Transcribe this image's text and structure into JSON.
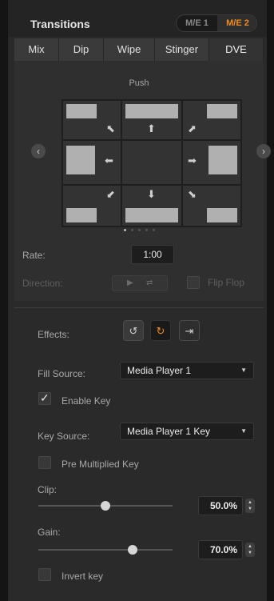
{
  "panel": {
    "title": "Transitions",
    "me_left": "M/E 1",
    "me_right": "M/E 2"
  },
  "tabs": [
    {
      "label": "Mix"
    },
    {
      "label": "Dip"
    },
    {
      "label": "Wipe"
    },
    {
      "label": "Stinger"
    },
    {
      "label": "DVE"
    }
  ],
  "dve": {
    "style_name": "Push",
    "page_count": 5,
    "active_page": 1
  },
  "rate": {
    "label": "Rate:",
    "value": "1:00"
  },
  "direction": {
    "label": "Direction:",
    "flip_flop": "Flip Flop"
  },
  "effects": {
    "label": "Effects:"
  },
  "fill_source": {
    "label": "Fill Source:",
    "value": "Media Player 1"
  },
  "enable_key": {
    "label": "Enable Key",
    "checked": true
  },
  "key_source": {
    "label": "Key Source:",
    "value": "Media Player 1 Key"
  },
  "pre_multiplied_key": {
    "label": "Pre Multiplied Key",
    "checked": false
  },
  "clip": {
    "label": "Clip:",
    "value": "50.0%",
    "level": 0.5
  },
  "gain": {
    "label": "Gain:",
    "value": "70.0%",
    "level": 0.7
  },
  "invert_key": {
    "label": "Invert key",
    "checked": false
  },
  "colors": {
    "accent": "#f28c1e"
  }
}
